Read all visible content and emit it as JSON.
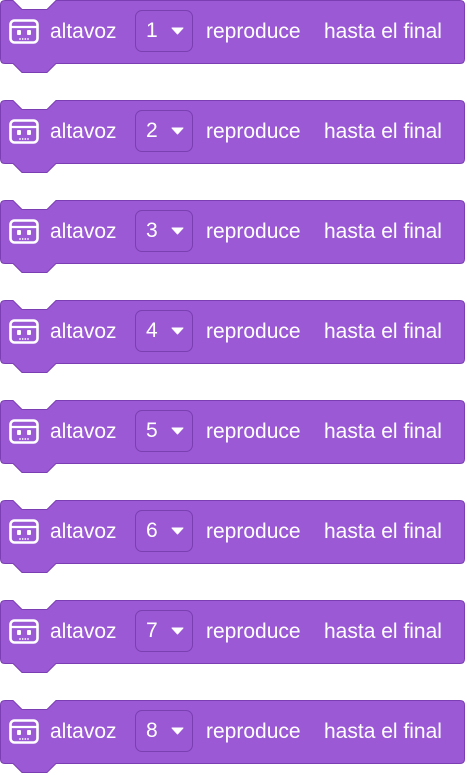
{
  "colors": {
    "block_fill": "#9b59d6",
    "block_border": "#7b3fb3",
    "text": "#ffffff"
  },
  "blocks": [
    {
      "icon": "robot-speaker-icon",
      "label": "altavoz",
      "value": "1",
      "action": "reproduce",
      "mode": "hasta el final"
    },
    {
      "icon": "robot-speaker-icon",
      "label": "altavoz",
      "value": "2",
      "action": "reproduce",
      "mode": "hasta el final"
    },
    {
      "icon": "robot-speaker-icon",
      "label": "altavoz",
      "value": "3",
      "action": "reproduce",
      "mode": "hasta el final"
    },
    {
      "icon": "robot-speaker-icon",
      "label": "altavoz",
      "value": "4",
      "action": "reproduce",
      "mode": "hasta el final"
    },
    {
      "icon": "robot-speaker-icon",
      "label": "altavoz",
      "value": "5",
      "action": "reproduce",
      "mode": "hasta el final"
    },
    {
      "icon": "robot-speaker-icon",
      "label": "altavoz",
      "value": "6",
      "action": "reproduce",
      "mode": "hasta el final"
    },
    {
      "icon": "robot-speaker-icon",
      "label": "altavoz",
      "value": "7",
      "action": "reproduce",
      "mode": "hasta el final"
    },
    {
      "icon": "robot-speaker-icon",
      "label": "altavoz",
      "value": "8",
      "action": "reproduce",
      "mode": "hasta el final"
    }
  ]
}
